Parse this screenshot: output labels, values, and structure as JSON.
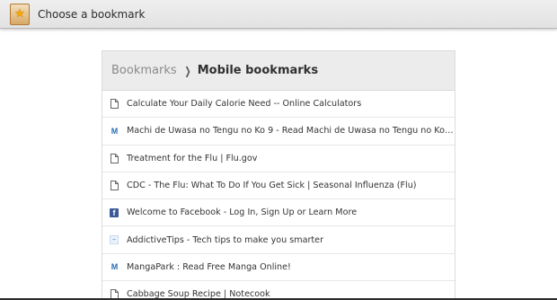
{
  "window": {
    "title": "Choose a bookmark",
    "icon": "star-bookmark-icon"
  },
  "breadcrumb": {
    "parent": "Bookmarks",
    "separator": "❯",
    "current": "Mobile bookmarks"
  },
  "bookmarks": [
    {
      "title": "Calculate Your Daily Calorie Need -- Online Calculators",
      "icon": "page-icon"
    },
    {
      "title": "Machi de Uwasa no Tengu no Ko 9 - Read Machi de Uwasa no Tengu no Ko vol.2 c...",
      "icon": "mangapark-icon"
    },
    {
      "title": "Treatment for the Flu | Flu.gov",
      "icon": "page-icon"
    },
    {
      "title": "CDC - The Flu: What To Do If You Get Sick | Seasonal Influenza (Flu)",
      "icon": "page-icon"
    },
    {
      "title": "Welcome to Facebook - Log In, Sign Up or Learn More",
      "icon": "facebook-icon"
    },
    {
      "title": "AddictiveTips - Tech tips to make you smarter",
      "icon": "addictivetips-icon"
    },
    {
      "title": "MangaPark : Read Free Manga Online!",
      "icon": "mangapark-icon"
    },
    {
      "title": "Cabbage Soup Recipe | Notecook",
      "icon": "page-icon"
    }
  ],
  "colors": {
    "facebook": "#3b5998",
    "mangapark": "#2a6db5",
    "star": "#f7a800"
  }
}
